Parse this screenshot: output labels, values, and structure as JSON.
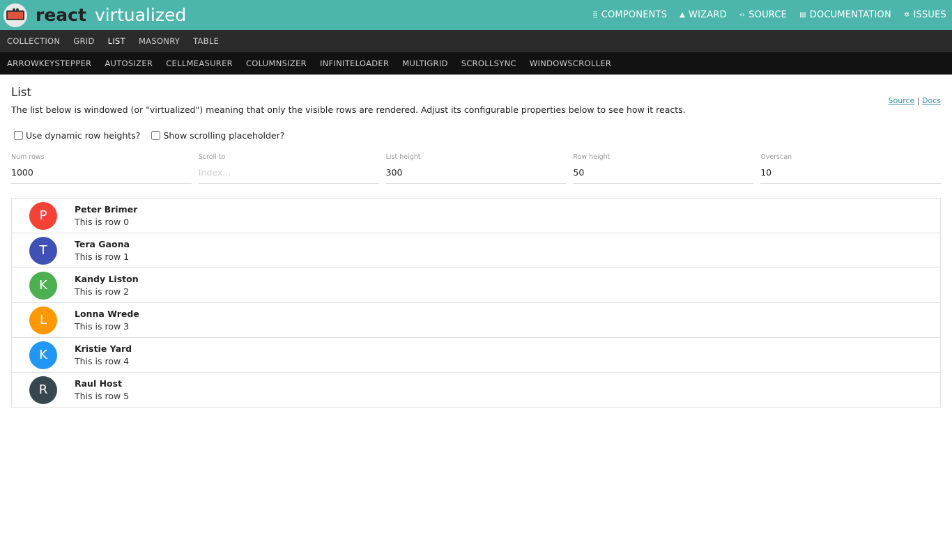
{
  "brand": {
    "bold": "react",
    "light": "virtualized"
  },
  "topnav": [
    {
      "icon": "grid-icon",
      "glyph": "⣿",
      "label": "COMPONENTS"
    },
    {
      "icon": "wizard-icon",
      "glyph": "▲",
      "label": "WIZARD"
    },
    {
      "icon": "code-icon",
      "glyph": "‹›",
      "label": "SOURCE"
    },
    {
      "icon": "book-icon",
      "glyph": "▤",
      "label": "DOCUMENTATION"
    },
    {
      "icon": "bug-icon",
      "glyph": "✲",
      "label": "ISSUES"
    }
  ],
  "nav1": [
    "COLLECTION",
    "GRID",
    "LIST",
    "MASONRY",
    "TABLE"
  ],
  "nav2": [
    "ARROWKEYSTEPPER",
    "AUTOSIZER",
    "CELLMEASURER",
    "COLUMNSIZER",
    "INFINITELOADER",
    "MULTIGRID",
    "SCROLLSYNC",
    "WINDOWSCROLLER"
  ],
  "page": {
    "title": "List",
    "source_link": "Source",
    "separator": "|",
    "docs_link": "Docs",
    "description": "The list below is windowed (or \"virtualized\") meaning that only the visible rows are rendered. Adjust its configurable properties below to see how it reacts."
  },
  "checks": {
    "dynamic": "Use dynamic row heights?",
    "placeholder": "Show scrolling placeholder?"
  },
  "fields": {
    "num_rows": {
      "label": "Num rows",
      "value": "1000"
    },
    "scroll_to": {
      "label": "Scroll to",
      "placeholder": "Index..."
    },
    "list_height": {
      "label": "List height",
      "value": "300"
    },
    "row_height": {
      "label": "Row height",
      "value": "50"
    },
    "overscan": {
      "label": "Overscan",
      "value": "10"
    }
  },
  "rows": [
    {
      "initial": "P",
      "name": "Peter Brimer",
      "sub": "This is row 0",
      "color": "#f44336"
    },
    {
      "initial": "T",
      "name": "Tera Gaona",
      "sub": "This is row 1",
      "color": "#3f51b5"
    },
    {
      "initial": "K",
      "name": "Kandy Liston",
      "sub": "This is row 2",
      "color": "#4caf50"
    },
    {
      "initial": "L",
      "name": "Lonna Wrede",
      "sub": "This is row 3",
      "color": "#ff9800"
    },
    {
      "initial": "K",
      "name": "Kristie Yard",
      "sub": "This is row 4",
      "color": "#2196f3"
    },
    {
      "initial": "R",
      "name": "Raul Host",
      "sub": "This is row 5",
      "color": "#37474f"
    }
  ]
}
